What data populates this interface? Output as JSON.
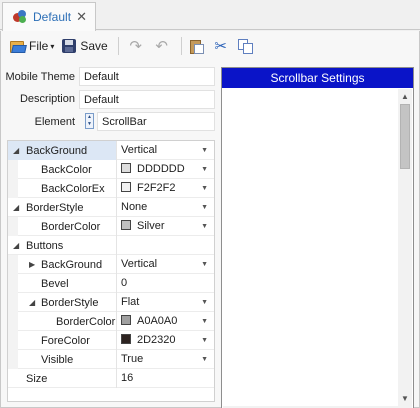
{
  "tab": {
    "label": "Default",
    "close": "✕"
  },
  "toolbar": {
    "file_label": "File",
    "file_caret": "▾",
    "save_label": "Save",
    "redo_glyph": "↷",
    "undo_glyph": "↶",
    "cut_glyph": "✂"
  },
  "form": {
    "mobile_theme_label": "Mobile Theme",
    "mobile_theme_value": "Default",
    "description_label": "Description",
    "description_value": "Default",
    "element_label": "Element",
    "element_value": "ScrollBar",
    "spin_up": "▲",
    "spin_down": "▼"
  },
  "grid": {
    "rows": [
      {
        "name": "BackGround",
        "value": "Vertical",
        "expander": "◢",
        "dropdown": "▼"
      },
      {
        "name": "BackColor",
        "value": "DDDDDD",
        "swatch": "#DDDDDD",
        "dropdown": "▼"
      },
      {
        "name": "BackColorEx",
        "value": "F2F2F2",
        "swatch": "#F2F2F2",
        "dropdown": "▼"
      },
      {
        "name": "BorderStyle",
        "value": "None",
        "expander": "◢",
        "dropdown": "▼"
      },
      {
        "name": "BorderColor",
        "value": "Silver",
        "swatch": "#C0C0C0",
        "dropdown": "▼"
      },
      {
        "name": "Buttons",
        "value": "",
        "expander": "◢"
      },
      {
        "name": "BackGround",
        "value": "Vertical",
        "expander": "▶",
        "dropdown": "▼"
      },
      {
        "name": "Bevel",
        "value": "0"
      },
      {
        "name": "BorderStyle",
        "value": "Flat",
        "expander": "◢",
        "dropdown": "▼"
      },
      {
        "name": "BorderColor",
        "value": "A0A0A0",
        "swatch": "#A0A0A0",
        "dropdown": "▼"
      },
      {
        "name": "ForeColor",
        "value": "2D2320",
        "swatch": "#2D2320",
        "dropdown": "▼"
      },
      {
        "name": "Visible",
        "value": "True",
        "dropdown": "▼"
      },
      {
        "name": "Size",
        "value": "16"
      }
    ]
  },
  "preview": {
    "title": "Scrollbar Settings",
    "header_color": "#0A14C8",
    "arrow_up": "▲",
    "arrow_down": "▼",
    "arrow_left": "◀",
    "arrow_right": "▶"
  }
}
